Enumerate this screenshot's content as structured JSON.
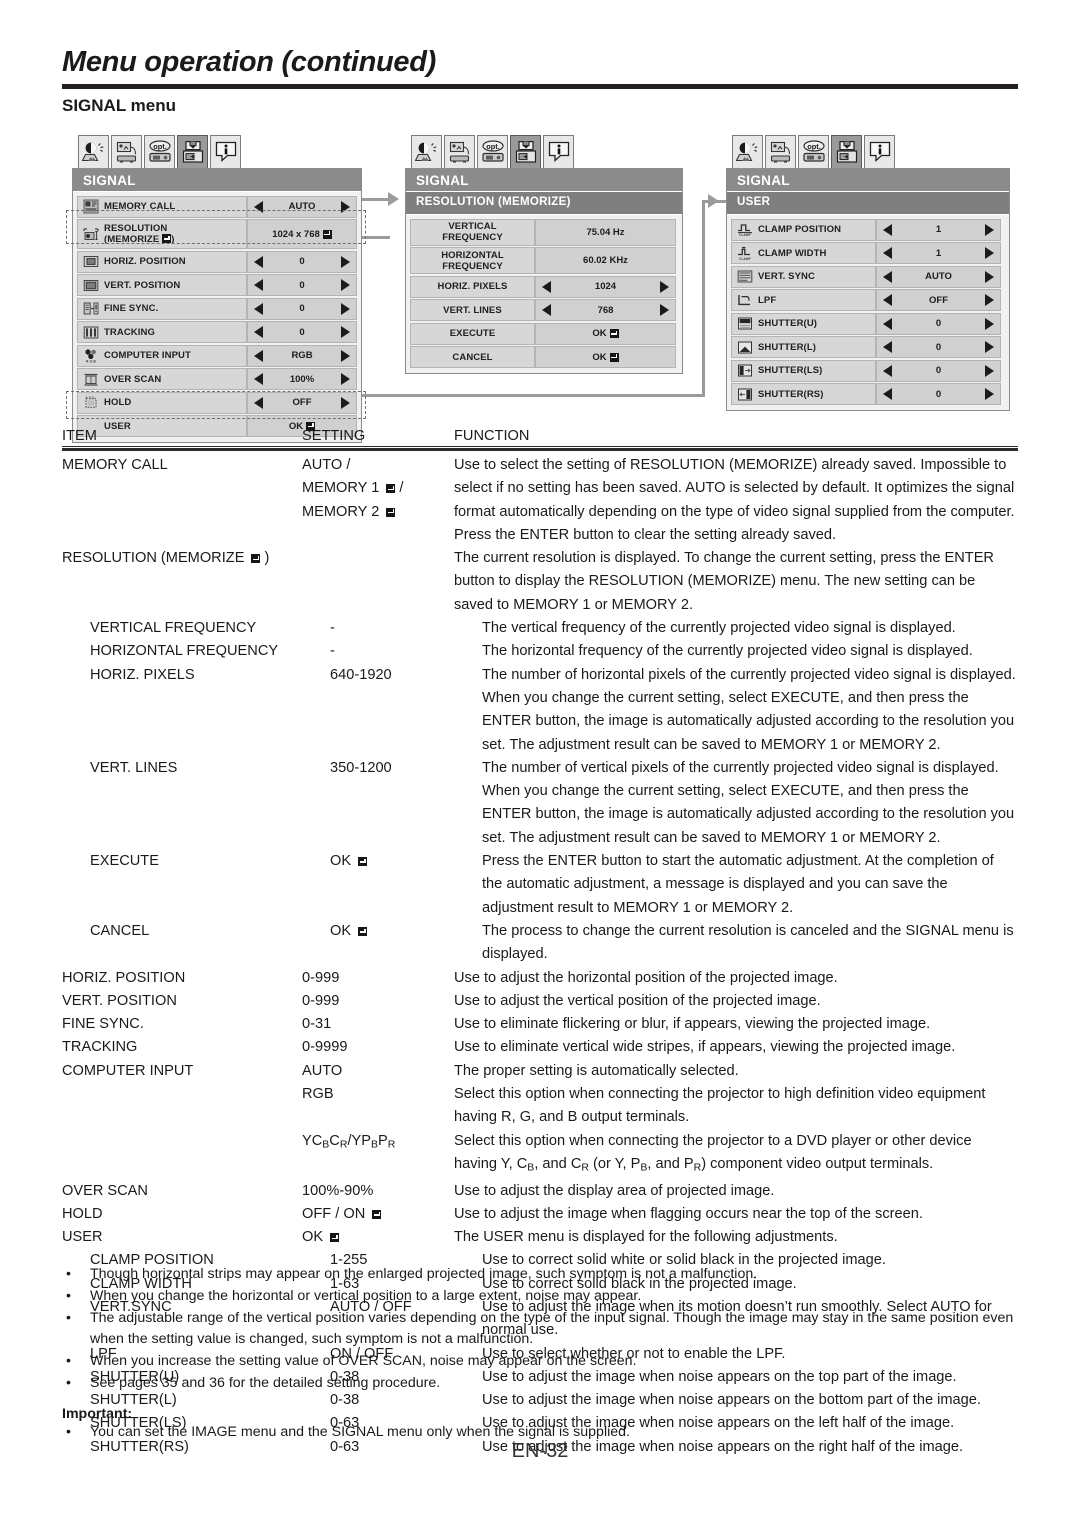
{
  "header": {
    "title": "Menu operation (continued)",
    "section": "SIGNAL menu"
  },
  "osd": {
    "tabs": [
      "image-tab-icon",
      "installation-tab-icon",
      "option-tab-icon",
      "signal-tab-icon",
      "info-tab-icon"
    ],
    "option_tab_label": "opt.",
    "info_tab_label": "i",
    "panel1": {
      "title": "SIGNAL",
      "rows": [
        {
          "icon": "memory-call-icon",
          "label": "MEMORY CALL",
          "value": "AUTO",
          "arrows": true
        },
        {
          "icon": "resolution-icon",
          "label": "RESOLUTION",
          "label2": "(MEMORIZE",
          "label2b": ")",
          "value": "1024 x 768",
          "arrows": false,
          "enter": true,
          "highlight": true
        },
        {
          "icon": "horiz-position-icon",
          "label": "HORIZ. POSITION",
          "value": "0",
          "arrows": true
        },
        {
          "icon": "vert-position-icon",
          "label": "VERT. POSITION",
          "value": "0",
          "arrows": true
        },
        {
          "icon": "fine-sync-icon",
          "label": "FINE SYNC.",
          "value": "0",
          "arrows": true
        },
        {
          "icon": "tracking-icon",
          "label": "TRACKING",
          "value": "0",
          "arrows": true
        },
        {
          "icon": "computer-input-icon",
          "label": "COMPUTER INPUT",
          "value": "RGB",
          "arrows": true
        },
        {
          "icon": "over-scan-icon",
          "label": "OVER SCAN",
          "value": "100%",
          "arrows": true
        },
        {
          "icon": "hold-icon",
          "label": "HOLD",
          "value": "OFF",
          "arrows": true
        },
        {
          "icon": "",
          "label": "USER",
          "value": "OK",
          "arrows": false,
          "enter": true,
          "highlight": true
        }
      ]
    },
    "panel2": {
      "title": "SIGNAL",
      "subtitle": "RESOLUTION (MEMORIZE)",
      "rows": [
        {
          "label": "VERTICAL",
          "label2": "FREQUENCY",
          "value": "75.04 Hz",
          "arrows": false
        },
        {
          "label": "HORIZONTAL",
          "label2": "FREQUENCY",
          "value": "60.02 KHz",
          "arrows": false
        },
        {
          "label": "HORIZ. PIXELS",
          "value": "1024",
          "arrows": true
        },
        {
          "label": "VERT. LINES",
          "value": "768",
          "arrows": true
        },
        {
          "label": "EXECUTE",
          "value": "OK",
          "arrows": false,
          "enter": true
        },
        {
          "label": "CANCEL",
          "value": "OK",
          "arrows": false,
          "enter": true
        }
      ]
    },
    "panel3": {
      "title": "SIGNAL",
      "subtitle": "USER",
      "rows": [
        {
          "icon": "clamp-position-icon",
          "label": "CLAMP POSITION",
          "value": "1",
          "arrows": true
        },
        {
          "icon": "clamp-width-icon",
          "label": "CLAMP WIDTH",
          "value": "1",
          "arrows": true
        },
        {
          "icon": "vert-sync-icon",
          "label": "VERT. SYNC",
          "value": "AUTO",
          "arrows": true
        },
        {
          "icon": "lpf-icon",
          "label": "LPF",
          "value": "OFF",
          "arrows": true
        },
        {
          "icon": "shutter-u-icon",
          "label": "SHUTTER(U)",
          "value": "0",
          "arrows": true
        },
        {
          "icon": "shutter-l-icon",
          "label": "SHUTTER(L)",
          "value": "0",
          "arrows": true
        },
        {
          "icon": "shutter-ls-icon",
          "label": "SHUTTER(LS)",
          "value": "0",
          "arrows": true
        },
        {
          "icon": "shutter-rs-icon",
          "label": "SHUTTER(RS)",
          "value": "0",
          "arrows": true
        }
      ]
    }
  },
  "table": {
    "headers": [
      "ITEM",
      "SETTING",
      "FUNCTION"
    ],
    "rows": [
      {
        "item": "MEMORY CALL",
        "indent": 0,
        "setting_lines": [
          "AUTO /",
          "MEMORY 1 ↵ /",
          "MEMORY 2 ↵"
        ],
        "function": "Use to select the setting of RESOLUTION (MEMORIZE) already saved. Impossible to select if no setting has been saved. AUTO is selected by default. It optimizes the signal format automatically depending on the type of video signal supplied from the computer. Press the ENTER button to clear the setting already saved."
      },
      {
        "item": "RESOLUTION (MEMORIZE ↵ )",
        "indent": 0,
        "setting_lines": [],
        "function": "The current resolution is displayed. To change the current setting, press the ENTER button to display the RESOLUTION (MEMORIZE) menu. The new setting can be saved to MEMORY 1 or MEMORY 2."
      },
      {
        "item": "VERTICAL FREQUENCY",
        "indent": 1,
        "setting_lines": [
          "-"
        ],
        "function": "The vertical frequency of the currently projected video signal is displayed."
      },
      {
        "item": "HORIZONTAL FREQUENCY",
        "indent": 1,
        "setting_lines": [
          "-"
        ],
        "function": "The horizontal frequency of the currently projected video signal is displayed."
      },
      {
        "item": "HORIZ. PIXELS",
        "indent": 1,
        "setting_lines": [
          "640-1920"
        ],
        "function": "The number of horizontal pixels of the currently projected video signal is displayed. When you change the current setting, select EXECUTE, and then press the ENTER button, the image is automatically adjusted according to the resolution you set. The adjustment result can be saved to MEMORY 1 or MEMORY 2."
      },
      {
        "item": "VERT. LINES",
        "indent": 1,
        "setting_lines": [
          "350-1200"
        ],
        "function": "The number of vertical pixels of the currently projected video signal is displayed. When you change the current setting, select EXECUTE, and then press the ENTER button, the image is automatically adjusted according to the resolution you set. The adjustment result can be saved to MEMORY 1 or MEMORY 2."
      },
      {
        "item": "EXECUTE",
        "indent": 1,
        "setting_lines": [
          "OK ↵"
        ],
        "function": "Press the ENTER button to start the automatic adjustment. At the completion of the automatic adjustment, a message is displayed and you can save the adjustment result to MEMORY 1 or MEMORY 2."
      },
      {
        "item": "CANCEL",
        "indent": 1,
        "setting_lines": [
          "OK ↵"
        ],
        "function": "The process to change the current resolution is canceled and the SIGNAL menu is displayed."
      },
      {
        "item": "HORIZ. POSITION",
        "indent": 0,
        "setting_lines": [
          "0-999"
        ],
        "function": "Use to adjust the horizontal position of the projected image."
      },
      {
        "item": "VERT. POSITION",
        "indent": 0,
        "setting_lines": [
          "0-999"
        ],
        "function": "Use to adjust the vertical position of the projected image."
      },
      {
        "item": "FINE SYNC.",
        "indent": 0,
        "setting_lines": [
          "0-31"
        ],
        "function": "Use to eliminate flickering or blur, if appears, viewing the projected image."
      },
      {
        "item": "TRACKING",
        "indent": 0,
        "setting_lines": [
          "0-9999"
        ],
        "function": "Use to eliminate vertical wide stripes, if appears, viewing the projected image."
      },
      {
        "item": "COMPUTER INPUT",
        "indent": 0,
        "setting_lines": [
          "AUTO"
        ],
        "function": "The proper setting is automatically selected."
      },
      {
        "item": "",
        "indent": 0,
        "setting_lines": [
          "RGB"
        ],
        "function": "Select this option when connecting the projector to high definition video equipment having R, G, and B output terminals."
      },
      {
        "item": "",
        "indent": 0,
        "setting_html": "YC<sub>B</sub>C<sub>R</sub>/YP<sub>B</sub>P<sub>R</sub>",
        "setting_lines": [],
        "function_html": "Select this option when connecting the projector to a DVD player or other device having Y, C<sub>B</sub>, and C<sub>R</sub> (or Y, P<sub>B</sub>, and P<sub>R</sub>) component video output terminals."
      },
      {
        "item": "OVER SCAN",
        "indent": 0,
        "setting_lines": [
          "100%-90%"
        ],
        "function": "Use to adjust the display area of projected image."
      },
      {
        "item": "HOLD",
        "indent": 0,
        "setting_lines": [
          "OFF / ON ↵"
        ],
        "function": "Use to adjust the image when flagging occurs near the top of the screen."
      },
      {
        "item": "USER",
        "indent": 0,
        "setting_lines": [
          "OK ↵"
        ],
        "function": "The USER menu is displayed for the following adjustments."
      },
      {
        "item": "CLAMP POSITION",
        "indent": 1,
        "setting_lines": [
          "1-255"
        ],
        "function": "Use to correct solid white or solid black in the projected image."
      },
      {
        "item": "CLAMP WIDTH",
        "indent": 1,
        "setting_lines": [
          "1-63"
        ],
        "function": "Use to correct solid black in the projected image."
      },
      {
        "item": "VERT.SYNC",
        "indent": 1,
        "setting_lines": [
          "AUTO / OFF"
        ],
        "function": "Use to adjust the image when its motion doesn’t run smoothly. Select AUTO for normal use."
      },
      {
        "item": "LPF",
        "indent": 1,
        "setting_lines": [
          "ON / OFF"
        ],
        "function": "Use to select whether or not to enable the LPF."
      },
      {
        "item": "SHUTTER(U)",
        "indent": 1,
        "setting_lines": [
          "0-38"
        ],
        "function": "Use to adjust the image when noise appears on the top part of the image."
      },
      {
        "item": "SHUTTER(L)",
        "indent": 1,
        "setting_lines": [
          "0-38"
        ],
        "function": "Use to adjust the image when noise appears on the bottom part of the image."
      },
      {
        "item": "SHUTTER(LS)",
        "indent": 1,
        "setting_lines": [
          "0-63"
        ],
        "function": "Use to adjust the image when noise appears on the left half of the image."
      },
      {
        "item": "SHUTTER(RS)",
        "indent": 1,
        "setting_lines": [
          "0-63"
        ],
        "function": "Use to adjust the image when noise appears on the right half of the image."
      }
    ]
  },
  "notes": {
    "bullet": "•",
    "items": [
      "Though horizontal strips may appear on the enlarged projected image, such symptom is not a malfunction.",
      "When you change the horizontal or vertical position to a large extent, noise may appear.",
      "The adjustable range of the vertical position varies depending on the type of the input signal. Though the image may stay in the same position even when the setting value is changed, such symptom is not a malfunction.",
      "When you increase the setting value of OVER SCAN, noise may appear on the screen.",
      "See pages 35 and 36 for the detailed setting procedure."
    ],
    "important_label": "Important:",
    "important_items": [
      "You can set the IMAGE menu and the SIGNAL menu only when the signal is supplied."
    ]
  },
  "footer": {
    "page": "EN-32"
  }
}
